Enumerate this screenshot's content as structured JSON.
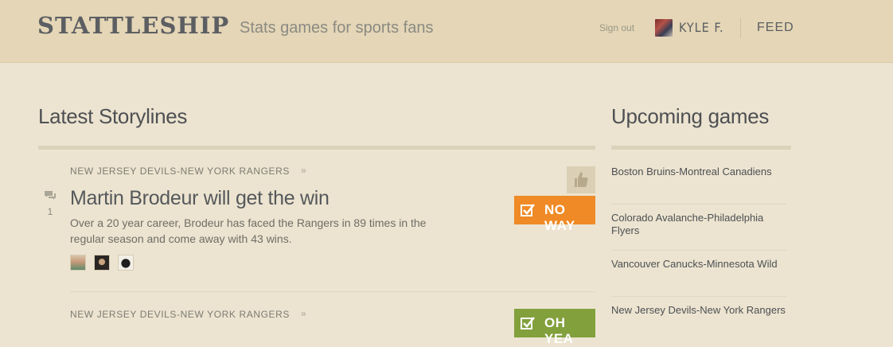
{
  "header": {
    "logo": "STATTLESHIP",
    "tagline": "Stats games for sports fans",
    "signout_label": "Sign out",
    "username": "KYLE F.",
    "feed_label": "FEED"
  },
  "storylines": {
    "title": "Latest Storylines",
    "items": [
      {
        "category": "NEW JERSEY DEVILS-NEW YORK RANGERS",
        "title": "Martin Brodeur will get the win",
        "description": "Over a 20 year career, Brodeur has faced the Rangers in 89 times in the regular season and come away with 43 wins.",
        "comment_count": "1",
        "vote_label": "NO WAY"
      },
      {
        "category": "NEW JERSEY DEVILS-NEW YORK RANGERS",
        "vote_label": "OH YEA"
      }
    ],
    "chevron": "»"
  },
  "upcoming": {
    "title": "Upcoming games",
    "games": [
      "Boston Bruins-Montreal Canadiens",
      "Colorado Avalanche-Philadelphia Flyers",
      "Vancouver Canucks-Minnesota Wild",
      "New Jersey Devils-New York Rangers"
    ]
  },
  "colors": {
    "header_bg": "#e4d6b6",
    "page_bg": "#ece4d0",
    "no_way": "#ef8a26",
    "oh_yea": "#82a03c",
    "text_dark": "#4e5054"
  }
}
